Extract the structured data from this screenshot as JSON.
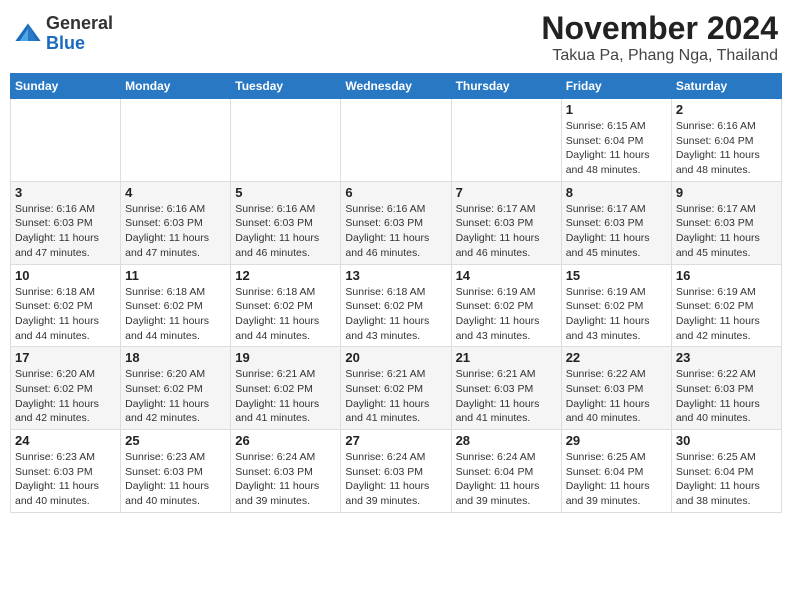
{
  "header": {
    "logo": {
      "general": "General",
      "blue": "Blue"
    },
    "title": "November 2024",
    "location": "Takua Pa, Phang Nga, Thailand"
  },
  "calendar": {
    "days_of_week": [
      "Sunday",
      "Monday",
      "Tuesday",
      "Wednesday",
      "Thursday",
      "Friday",
      "Saturday"
    ],
    "weeks": [
      [
        {
          "day": "",
          "info": ""
        },
        {
          "day": "",
          "info": ""
        },
        {
          "day": "",
          "info": ""
        },
        {
          "day": "",
          "info": ""
        },
        {
          "day": "",
          "info": ""
        },
        {
          "day": "1",
          "info": "Sunrise: 6:15 AM\nSunset: 6:04 PM\nDaylight: 11 hours and 48 minutes."
        },
        {
          "day": "2",
          "info": "Sunrise: 6:16 AM\nSunset: 6:04 PM\nDaylight: 11 hours and 48 minutes."
        }
      ],
      [
        {
          "day": "3",
          "info": "Sunrise: 6:16 AM\nSunset: 6:03 PM\nDaylight: 11 hours and 47 minutes."
        },
        {
          "day": "4",
          "info": "Sunrise: 6:16 AM\nSunset: 6:03 PM\nDaylight: 11 hours and 47 minutes."
        },
        {
          "day": "5",
          "info": "Sunrise: 6:16 AM\nSunset: 6:03 PM\nDaylight: 11 hours and 46 minutes."
        },
        {
          "day": "6",
          "info": "Sunrise: 6:16 AM\nSunset: 6:03 PM\nDaylight: 11 hours and 46 minutes."
        },
        {
          "day": "7",
          "info": "Sunrise: 6:17 AM\nSunset: 6:03 PM\nDaylight: 11 hours and 46 minutes."
        },
        {
          "day": "8",
          "info": "Sunrise: 6:17 AM\nSunset: 6:03 PM\nDaylight: 11 hours and 45 minutes."
        },
        {
          "day": "9",
          "info": "Sunrise: 6:17 AM\nSunset: 6:03 PM\nDaylight: 11 hours and 45 minutes."
        }
      ],
      [
        {
          "day": "10",
          "info": "Sunrise: 6:18 AM\nSunset: 6:02 PM\nDaylight: 11 hours and 44 minutes."
        },
        {
          "day": "11",
          "info": "Sunrise: 6:18 AM\nSunset: 6:02 PM\nDaylight: 11 hours and 44 minutes."
        },
        {
          "day": "12",
          "info": "Sunrise: 6:18 AM\nSunset: 6:02 PM\nDaylight: 11 hours and 44 minutes."
        },
        {
          "day": "13",
          "info": "Sunrise: 6:18 AM\nSunset: 6:02 PM\nDaylight: 11 hours and 43 minutes."
        },
        {
          "day": "14",
          "info": "Sunrise: 6:19 AM\nSunset: 6:02 PM\nDaylight: 11 hours and 43 minutes."
        },
        {
          "day": "15",
          "info": "Sunrise: 6:19 AM\nSunset: 6:02 PM\nDaylight: 11 hours and 43 minutes."
        },
        {
          "day": "16",
          "info": "Sunrise: 6:19 AM\nSunset: 6:02 PM\nDaylight: 11 hours and 42 minutes."
        }
      ],
      [
        {
          "day": "17",
          "info": "Sunrise: 6:20 AM\nSunset: 6:02 PM\nDaylight: 11 hours and 42 minutes."
        },
        {
          "day": "18",
          "info": "Sunrise: 6:20 AM\nSunset: 6:02 PM\nDaylight: 11 hours and 42 minutes."
        },
        {
          "day": "19",
          "info": "Sunrise: 6:21 AM\nSunset: 6:02 PM\nDaylight: 11 hours and 41 minutes."
        },
        {
          "day": "20",
          "info": "Sunrise: 6:21 AM\nSunset: 6:02 PM\nDaylight: 11 hours and 41 minutes."
        },
        {
          "day": "21",
          "info": "Sunrise: 6:21 AM\nSunset: 6:03 PM\nDaylight: 11 hours and 41 minutes."
        },
        {
          "day": "22",
          "info": "Sunrise: 6:22 AM\nSunset: 6:03 PM\nDaylight: 11 hours and 40 minutes."
        },
        {
          "day": "23",
          "info": "Sunrise: 6:22 AM\nSunset: 6:03 PM\nDaylight: 11 hours and 40 minutes."
        }
      ],
      [
        {
          "day": "24",
          "info": "Sunrise: 6:23 AM\nSunset: 6:03 PM\nDaylight: 11 hours and 40 minutes."
        },
        {
          "day": "25",
          "info": "Sunrise: 6:23 AM\nSunset: 6:03 PM\nDaylight: 11 hours and 40 minutes."
        },
        {
          "day": "26",
          "info": "Sunrise: 6:24 AM\nSunset: 6:03 PM\nDaylight: 11 hours and 39 minutes."
        },
        {
          "day": "27",
          "info": "Sunrise: 6:24 AM\nSunset: 6:03 PM\nDaylight: 11 hours and 39 minutes."
        },
        {
          "day": "28",
          "info": "Sunrise: 6:24 AM\nSunset: 6:04 PM\nDaylight: 11 hours and 39 minutes."
        },
        {
          "day": "29",
          "info": "Sunrise: 6:25 AM\nSunset: 6:04 PM\nDaylight: 11 hours and 39 minutes."
        },
        {
          "day": "30",
          "info": "Sunrise: 6:25 AM\nSunset: 6:04 PM\nDaylight: 11 hours and 38 minutes."
        }
      ]
    ]
  }
}
